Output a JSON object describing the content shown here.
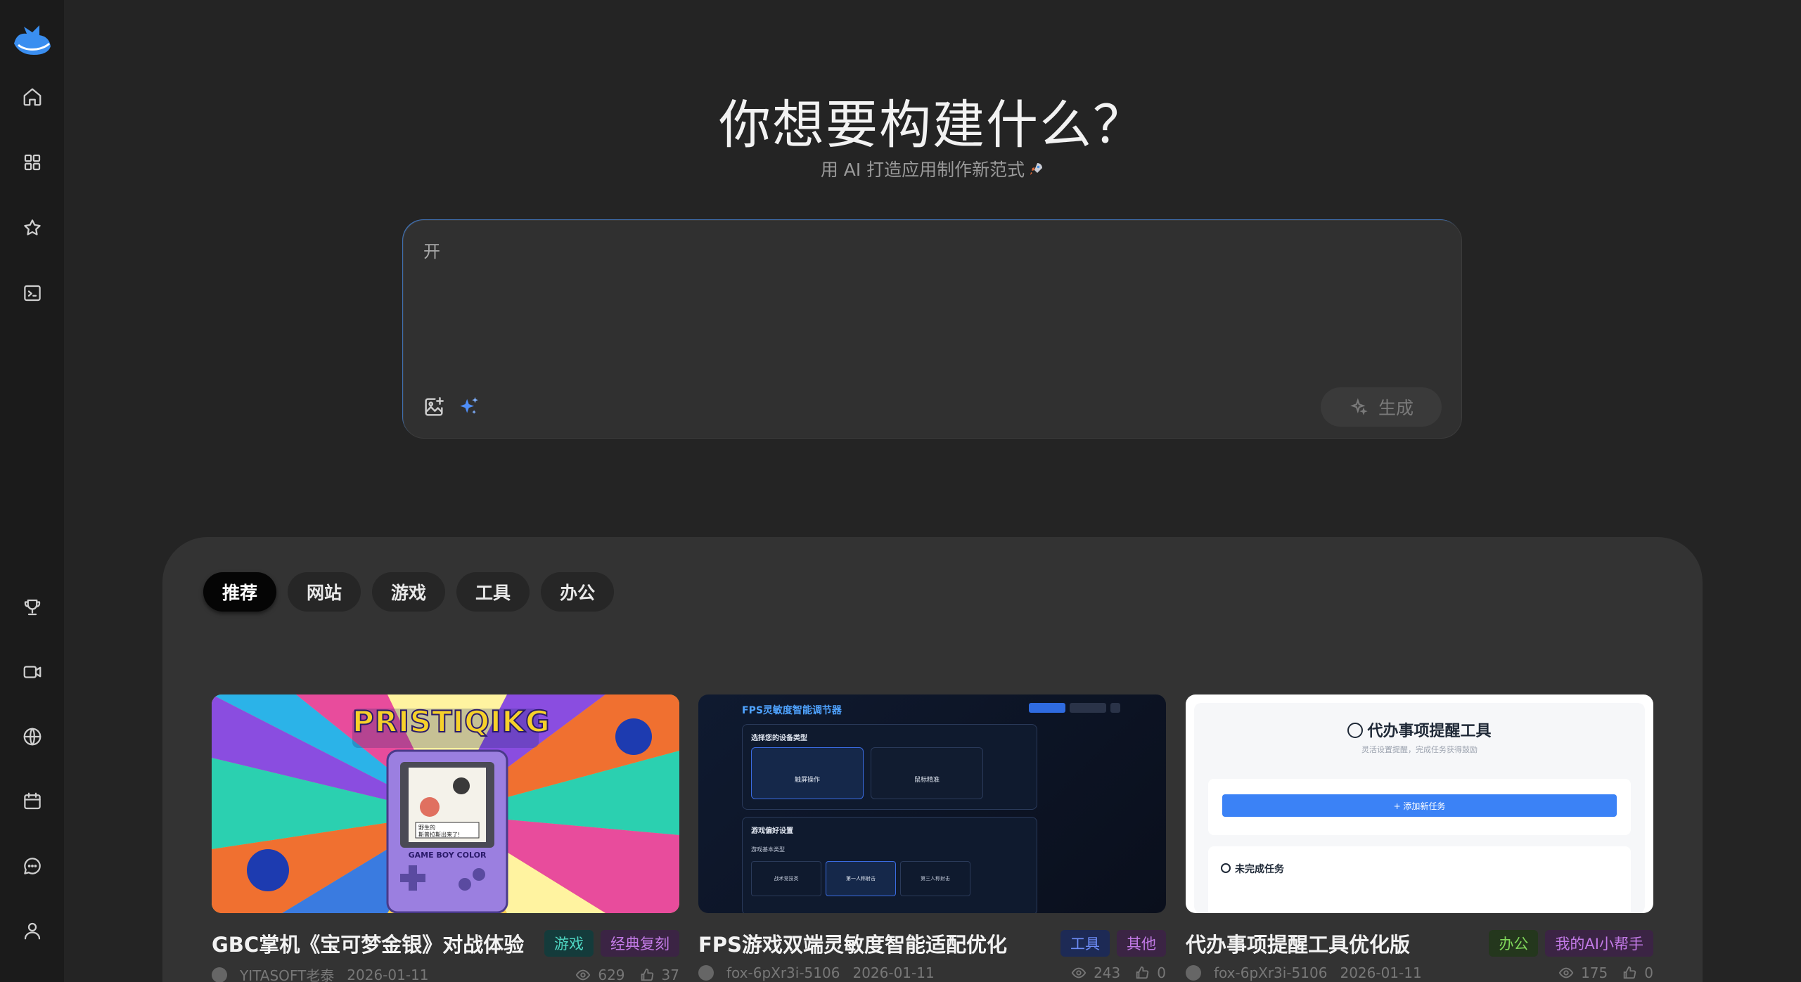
{
  "hero": {
    "title": "你想要构建什么？",
    "subtitle": "用 AI 打造应用制作新范式"
  },
  "prompt": {
    "value": "开",
    "generate_label": "生成"
  },
  "tabs": [
    {
      "label": "推荐",
      "active": true
    },
    {
      "label": "网站",
      "active": false
    },
    {
      "label": "游戏",
      "active": false
    },
    {
      "label": "工具",
      "active": false
    },
    {
      "label": "办公",
      "active": false
    }
  ],
  "cards": [
    {
      "title": "GBC掌机《宝可梦金银》对战体验",
      "tags": [
        "游戏",
        "经典复刻"
      ],
      "author": "YITASOFT老泰",
      "date": "2026-01-11",
      "views": "629",
      "likes": "37",
      "thumb": {
        "logo": "PRISTIQIKG",
        "device": "GAME BOY COLOR",
        "screen_lines": [
          "野生的",
          "斯普拉斯出来了!"
        ]
      }
    },
    {
      "title": "FPS游戏双端灵敏度智能适配优化",
      "tags": [
        "工具",
        "其他"
      ],
      "author": "fox-6pXr3i-5106",
      "date": "2026-01-11",
      "views": "243",
      "likes": "0",
      "thumb": {
        "header": "FPS灵敏度智能调节器",
        "section1": "选择您的设备类型",
        "opt1": "触屏操作",
        "opt2": "鼠标精准",
        "section2": "游戏偏好设置",
        "sub": "游戏基本类型",
        "modes": [
          "战术竞技类",
          "第一人称射击",
          "第三人称射击"
        ]
      }
    },
    {
      "title": "代办事项提醒工具优化版",
      "tags": [
        "办公",
        "我的AI小帮手"
      ],
      "author": "fox-6pXr3i-5106",
      "date": "2026-01-11",
      "views": "175",
      "likes": "0",
      "thumb": {
        "header": "代办事项提醒工具",
        "sub": "灵活设置提醒，完成任务获得鼓励",
        "button": "+ 添加新任务",
        "section": "未完成任务"
      }
    }
  ],
  "colors": {
    "accent_blue": "#3b82f6",
    "background": "#242424",
    "sidebar": "#1b1b1b",
    "panel": "#333333"
  },
  "icons": {
    "sidebar_top": [
      "home-icon",
      "grid-icon",
      "star-icon",
      "terminal-icon"
    ],
    "sidebar_bottom": [
      "trophy-icon",
      "video-icon",
      "globe-icon",
      "calendar-icon",
      "chat-icon",
      "user-icon"
    ]
  }
}
